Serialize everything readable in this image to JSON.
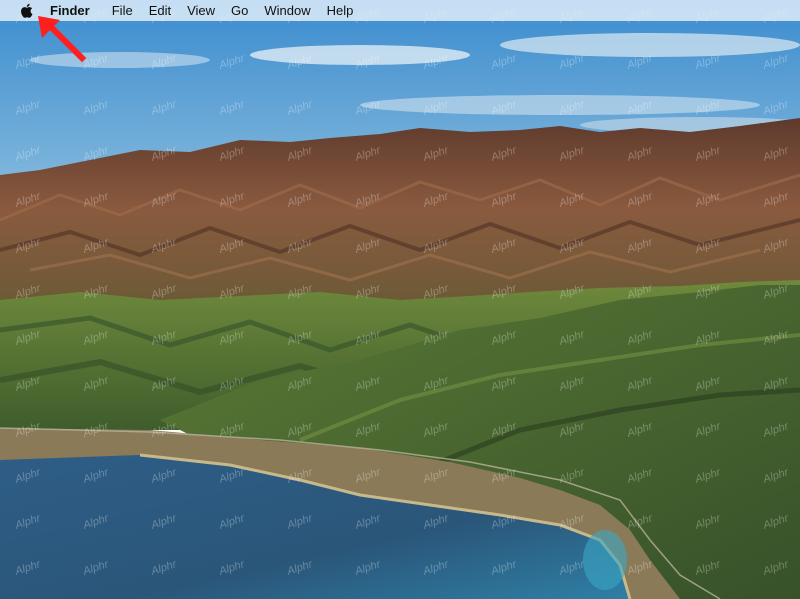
{
  "menubar": {
    "apple_icon": "apple-logo-icon",
    "app_name": "Finder",
    "items": [
      "File",
      "Edit",
      "View",
      "Go",
      "Window",
      "Help"
    ]
  },
  "watermark": {
    "text": "Alphr"
  },
  "annotation": {
    "icon": "arrow-icon",
    "color": "#ff1f1f"
  },
  "colors": {
    "sky_top": "#3f8fcf",
    "sky_bottom": "#b9d8ea",
    "ocean": "#2f5f86",
    "mountain_brown": "#7a4a35",
    "mountain_green": "#5f7f3b"
  }
}
